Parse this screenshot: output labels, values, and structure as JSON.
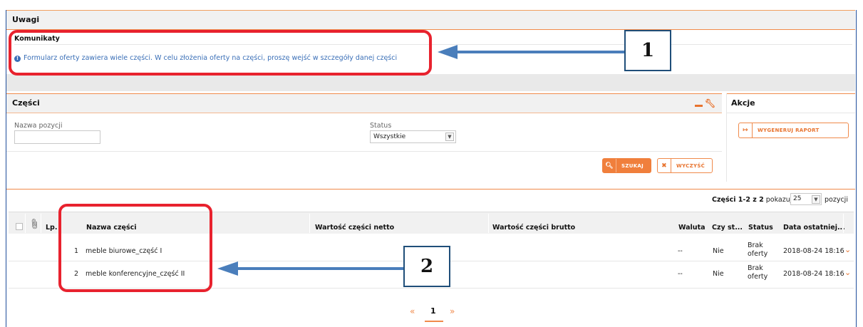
{
  "uwagi": {
    "title": "Uwagi",
    "komunikaty_title": "Komunikaty",
    "info_icon": "info-circle-icon",
    "message": "Formularz oferty zawiera wiele części. W celu złożenia oferty na części, proszę wejść w szczegóły danej części"
  },
  "czesci": {
    "title": "Części",
    "header_icons": [
      "minimize-icon",
      "wrench-icon"
    ],
    "filter": {
      "name_label": "Nazwa pozycji",
      "name_value": "",
      "status_label": "Status",
      "status_value": "Wszystkie"
    },
    "search_label": "SZUKAJ",
    "clear_label": "WYCZYŚĆ"
  },
  "akcje": {
    "title": "Akcje",
    "report_label": "WYGENERUJ RAPORT"
  },
  "pagination_info": {
    "range": "Części 1-2 z 2",
    "show_label": "pokazuj",
    "page_size": "25",
    "suffix": "pozycji"
  },
  "table": {
    "headers": {
      "lp": "Lp.",
      "name": "Nazwa części",
      "net": "Wartość części netto",
      "gross": "Wartość części brutto",
      "currency": "Waluta",
      "czy_st": "Czy st...",
      "status": "Status",
      "last": "Data ostatniej..."
    },
    "rows": [
      {
        "lp": "1",
        "name": "meble biurowe_część I",
        "net": "",
        "gross": "",
        "currency": "--",
        "czy_st": "Nie",
        "status_line1": "Brak",
        "status_line2": "oferty",
        "last": "2018-08-24 18:16"
      },
      {
        "lp": "2",
        "name": "meble konferencyjne_część II",
        "net": "",
        "gross": "",
        "currency": "--",
        "czy_st": "Nie",
        "status_line1": "Brak",
        "status_line2": "oferty",
        "last": "2018-08-24 18:16"
      }
    ]
  },
  "pager": {
    "prev": "«",
    "current": "1",
    "next": "»"
  },
  "annotations": {
    "callout1": "1",
    "callout2": "2"
  },
  "colors": {
    "accent": "#f07f3c",
    "callout_border": "#1f4e79",
    "arrow": "#4a7ebb",
    "highlight": "#e8222e",
    "link": "#3a6fb7"
  }
}
